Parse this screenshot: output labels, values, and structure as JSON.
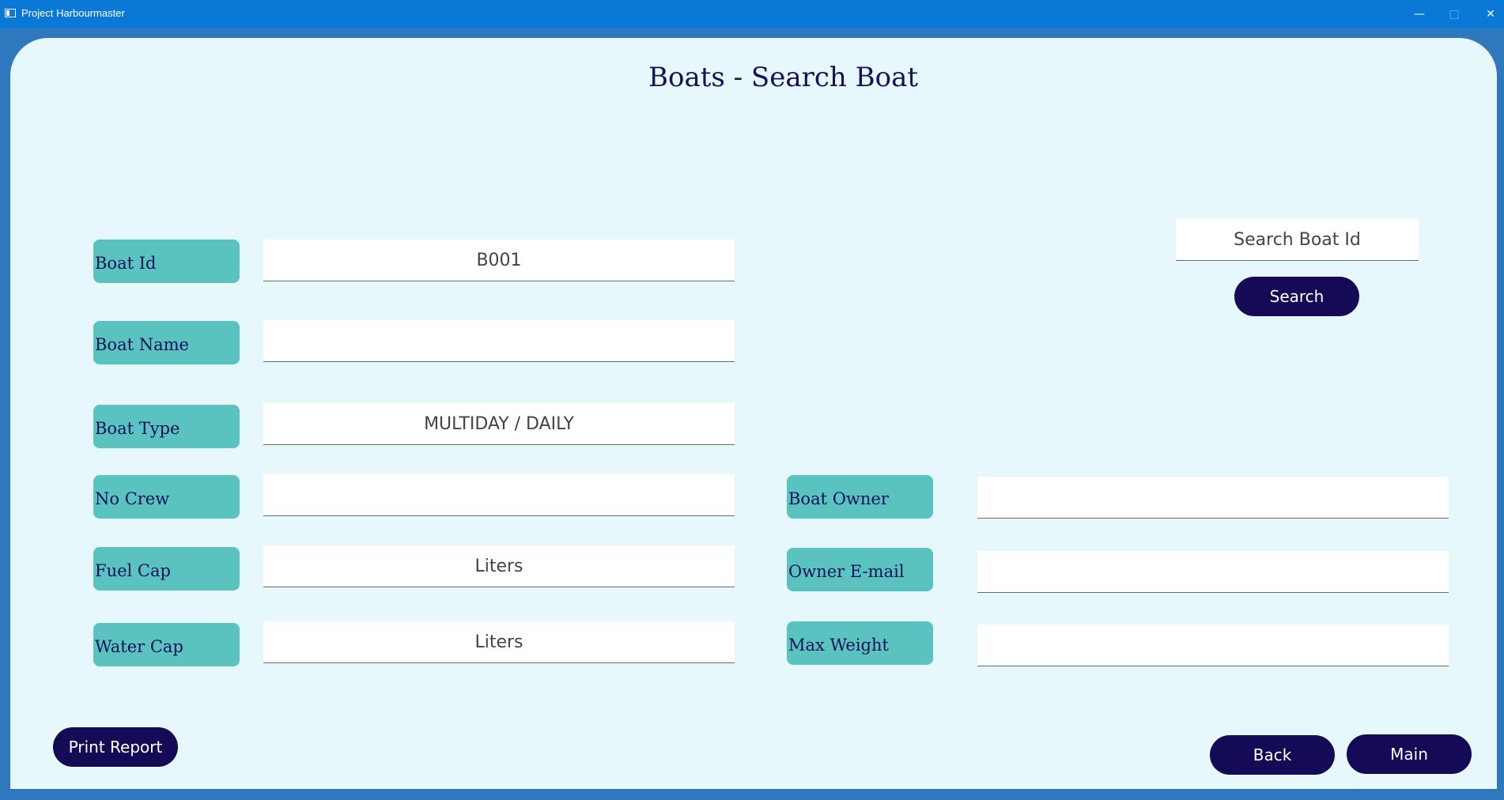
{
  "window": {
    "title": "Project Harbourmaster"
  },
  "page": {
    "title": "Boats - Search Boat"
  },
  "labels": {
    "boat_id": "Boat Id",
    "boat_name": "Boat Name",
    "boat_type": "Boat Type",
    "no_crew": "No Crew",
    "fuel_cap": "Fuel Cap",
    "water_cap": "Water Cap",
    "boat_owner": "Boat Owner",
    "owner_email": "Owner E-mail",
    "max_weight": "Max Weight"
  },
  "fields": {
    "boat_id": {
      "value": "",
      "placeholder": "B001"
    },
    "boat_name": {
      "value": "",
      "placeholder": ""
    },
    "boat_type": {
      "value": "",
      "placeholder": "MULTIDAY / DAILY"
    },
    "no_crew": {
      "value": "",
      "placeholder": ""
    },
    "fuel_cap": {
      "value": "",
      "placeholder": "Liters"
    },
    "water_cap": {
      "value": "",
      "placeholder": "Liters"
    },
    "boat_owner": {
      "value": "",
      "placeholder": ""
    },
    "owner_email": {
      "value": "",
      "placeholder": ""
    },
    "max_weight": {
      "value": "",
      "placeholder": ""
    }
  },
  "search": {
    "placeholder": "Search Boat Id",
    "value": "",
    "button_label": "Search"
  },
  "buttons": {
    "print_report": "Print Report",
    "back": "Back",
    "main": "Main"
  },
  "icons": {
    "window_minimize": "minimize-icon",
    "window_maximize": "maximize-icon",
    "window_close": "close-icon",
    "app": "app-window-icon"
  },
  "colors": {
    "titlebar": "#0a78d6",
    "panel_background": "#e6f8fc",
    "label_background": "#5ac2bf",
    "label_text": "#15115a",
    "button_background": "#140a56",
    "button_text": "#ffffff"
  }
}
